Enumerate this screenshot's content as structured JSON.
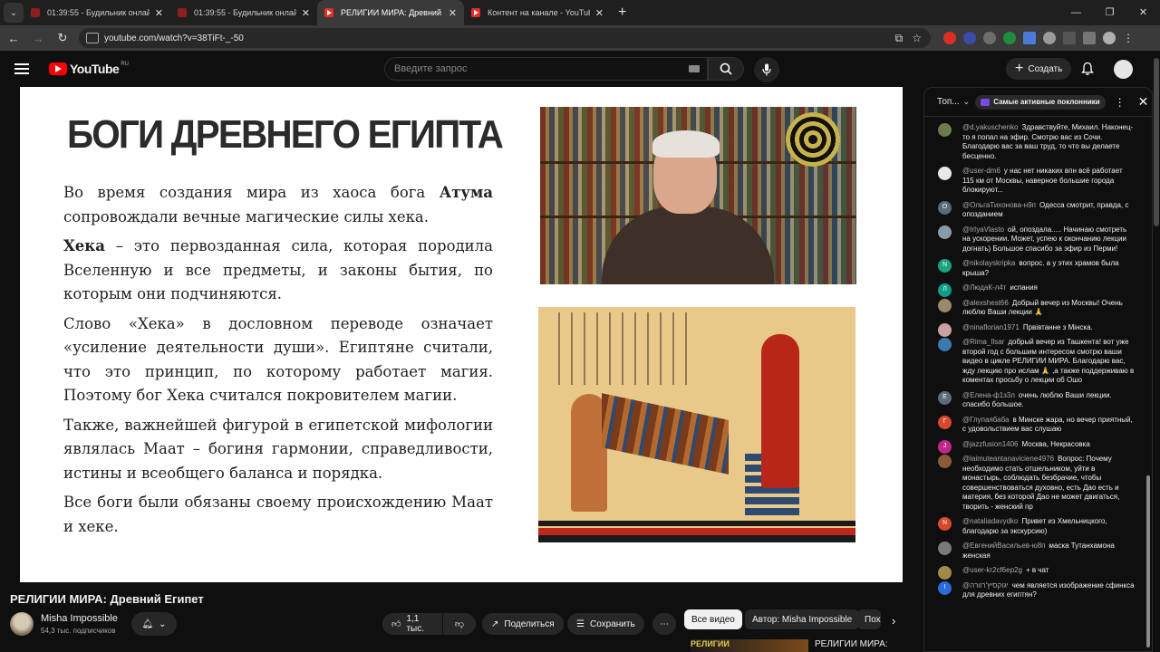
{
  "browser": {
    "tabs": [
      {
        "title": "01:39:55 - Будильник онлайн",
        "active": false,
        "icon": "clock"
      },
      {
        "title": "01:39:55 - Будильник онлайн",
        "active": false,
        "icon": "clock"
      },
      {
        "title": "РЕЛИГИИ МИРА: Древний Египет",
        "active": true,
        "icon": "youtube"
      },
      {
        "title": "Контент на канале - YouTube Studio",
        "active": false,
        "icon": "youtube"
      }
    ],
    "url": "youtube.com/watch?v=38TiFt-_-50"
  },
  "header": {
    "logo_text": "YouTube",
    "logo_region": "RU",
    "search_placeholder": "Введите запрос",
    "create_label": "Создать"
  },
  "slide": {
    "title": "БОГИ ДРЕВНЕГО ЕГИПТА",
    "paragraphs": [
      {
        "before": "Во время создания мира из хаоса бога ",
        "bold": "Атума",
        "after": " сопровождали вечные магические силы хека."
      },
      {
        "before": "",
        "bold": "Хека",
        "after": " – это первозданная сила, которая породила Вселенную и все предметы, и законы бытия, по которым они подчиняются."
      },
      {
        "before": "Слово «Хека» в дословном переводе означает «усиление деятельности души». Египтяне считали, что это принцип, по которому работает магия. Поэтому бог Хека считался покровителем магии.",
        "bold": "",
        "after": ""
      },
      {
        "before": "Также, важнейшей фигурой в египетской мифологии являлась Маат – богиня гармонии, справедливости, истины и всеобщего баланса и порядка.",
        "bold": "",
        "after": ""
      },
      {
        "before": "Все боги были обязаны своему происхождению Маат и хеке.",
        "bold": "",
        "after": ""
      }
    ]
  },
  "video": {
    "title": "РЕЛИГИИ МИРА: Древний Египет",
    "channel": "Misha Impossible",
    "subscribers": "54,3 тыс. подписчиков",
    "likes": "1,1 тыс.",
    "share_label": "Поделиться",
    "save_label": "Сохранить",
    "more_label": "⋯"
  },
  "chips": [
    "Все видео",
    "Автор: Misha Impossible",
    "Пох"
  ],
  "recommendation": {
    "thumb_text": "РЕЛИГИИ",
    "title": "РЕЛИГИИ МИРА:"
  },
  "chat": {
    "mode": "Топ...",
    "top_fans": "Самые активные поклонники",
    "messages": [
      {
        "author": "@d.yakuschenko",
        "text": "Здравствуйте, Михаил. Наконец-то я попал на эфир. Смотрю вас из Сочи. Благодарю вас за ваш труд, то что вы делаете бесценно.",
        "avatar": "",
        "color": "#6b7c4a"
      },
      {
        "author": "@user-dm6",
        "text": "у нас нет никаких впн всё работает 115 км от Москвы, наверное большие города блокируют...",
        "avatar": "",
        "color": "#e8e8e8"
      },
      {
        "author": "@ОльгаТихонова-н9п",
        "text": "Одесса смотрит, правда, с опозданием",
        "avatar": "О",
        "color": "#5a6b7a"
      },
      {
        "author": "@IrIyaVlasto",
        "text": "ой, опоздала..... Начинаю смотреть на ускорении. Может, успею к окончанию лекции догнать) Большое спасибо за эфир из Перми!",
        "avatar": "",
        "color": "#8a9ba8"
      },
      {
        "author": "@nikolayskripka",
        "text": "вопрос. а у этих храмов была крыша?",
        "avatar": "N",
        "color": "#1aa37a"
      },
      {
        "author": "@ЛюдаК-л4т",
        "text": "испания",
        "avatar": "Л",
        "color": "#0f9d8a"
      },
      {
        "author": "@alexshest66",
        "text": "Добрый вечер из Москвы! Очень люблю Ваши лекции 🙏",
        "avatar": "",
        "color": "#9a8a6a"
      },
      {
        "author": "@ninaflorian1971",
        "text": "Првівтанне з Мінска.",
        "avatar": "",
        "color": "#c9a0a0"
      },
      {
        "author": "@Rima_Ilsar",
        "text": "добрый вечер из Ташкента! вот уже второй год с большим интересом смотрю ваши видео в цикле РЕЛИГИИ МИРА. Благодарю вас, жду лекцию про ислам 🙏 ,а также поддерживаю в коментах просьбу о лекции об Ошо",
        "avatar": "",
        "color": "#3a7ab0"
      },
      {
        "author": "@Елена-ф1з3л",
        "text": "очень люблю Ваши лекции. спасибо большое.",
        "avatar": "Е",
        "color": "#5a6b7a"
      },
      {
        "author": "@Глупаябаба",
        "text": "в Минске жара, но вечер приятный, с удовольствием вас слушаю",
        "avatar": "Г",
        "color": "#d9482b"
      },
      {
        "author": "@jazzfusion1406",
        "text": "Москва, Некрасовка",
        "avatar": "J",
        "color": "#c0278a"
      },
      {
        "author": "@laimuteantanaviciene4976",
        "text": "Вопрос: Почему необходимо стать отшельником, уйти в монастырь, соблюдать безбрачие, чтобы совершенствоваться духовно, есть Дао есть и материя, без которой Дао не может двигаться, творить - женский пр",
        "avatar": "",
        "color": "#8a5a3a"
      },
      {
        "author": "@nataliadavydko",
        "text": "Привет из Хмельницкого, благодарю за экскурсию)",
        "avatar": "N",
        "color": "#d9482b"
      },
      {
        "author": "@ЕвгенийВасильев-ю8п",
        "text": "маска Тутанхамона женская",
        "avatar": "",
        "color": "#7a7a7a"
      },
      {
        "author": "@user-kr2cf6ep2g",
        "text": "+ в чат",
        "avatar": "",
        "color": "#a08a4a"
      },
      {
        "author": "@יגוקסיץ'רוורה",
        "text": "чем является изображение сфинкса для древних египтян?",
        "avatar": "I",
        "color": "#2a6ad9"
      }
    ]
  }
}
